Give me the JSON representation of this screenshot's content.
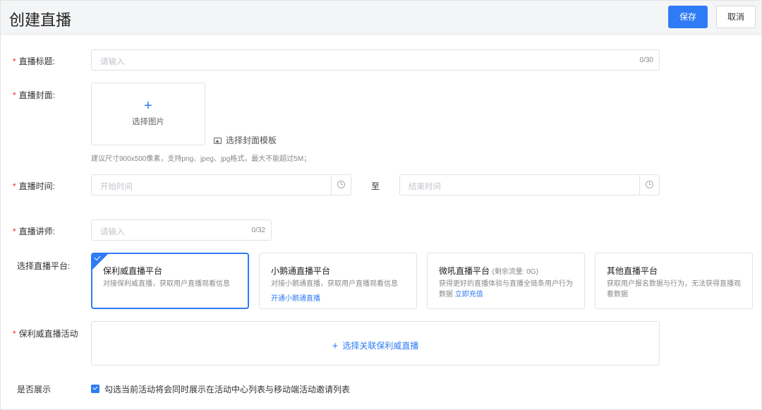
{
  "header": {
    "title": "创建直播",
    "save_label": "保存",
    "cancel_label": "取消"
  },
  "form": {
    "title_field": {
      "label": "直播标题:",
      "placeholder": "请输入",
      "counter": "0/30",
      "required": true
    },
    "cover_field": {
      "label": "直播封面:",
      "upload_plus": "+",
      "upload_text": "选择图片",
      "template_link": "选择封面模板",
      "hint": "建议尺寸900x500像素，支持png、jpeg、jpg格式，最大不能超过5M；"
    },
    "time_field": {
      "label": "直播时间:",
      "start_placeholder": "开始时间",
      "to_label": "至",
      "end_placeholder": "结束时间"
    },
    "lecturer_field": {
      "label": "直播讲师:",
      "placeholder": "请输入",
      "counter": "0/32"
    },
    "platform_field": {
      "label": "选择直播平台:",
      "cards": [
        {
          "title": "保利威直播平台",
          "desc": "对接保利威直播，获取用户直播观看信息",
          "selected": true
        },
        {
          "title": "小鹅通直播平台",
          "desc": "对接小鹅通直播，获取用户直播观看信息",
          "link": "开通小鹅通直播"
        },
        {
          "title": "微吼直播平台",
          "subtitle": "(剩余流量: 0G)",
          "desc": "获得更好的直播体验与直播全链条用户行为数据",
          "link": "立即充值"
        },
        {
          "title": "其他直播平台",
          "desc": "获取用户报名数据与行为，无法获得直播观看数据"
        }
      ]
    },
    "activity_field": {
      "label": "保利威直播活动",
      "plus": "+",
      "link": "选择关联保利威直播"
    },
    "display_field": {
      "label": "是否展示",
      "checkbox_label": "勾选当前活动将会同时展示在活动中心列表与移动端活动邀请列表",
      "checked": true
    }
  },
  "colors": {
    "primary": "#2f7bf5",
    "required": "#f5222d",
    "border": "#e2e2e2",
    "header_bg": "#f4f5f7"
  }
}
